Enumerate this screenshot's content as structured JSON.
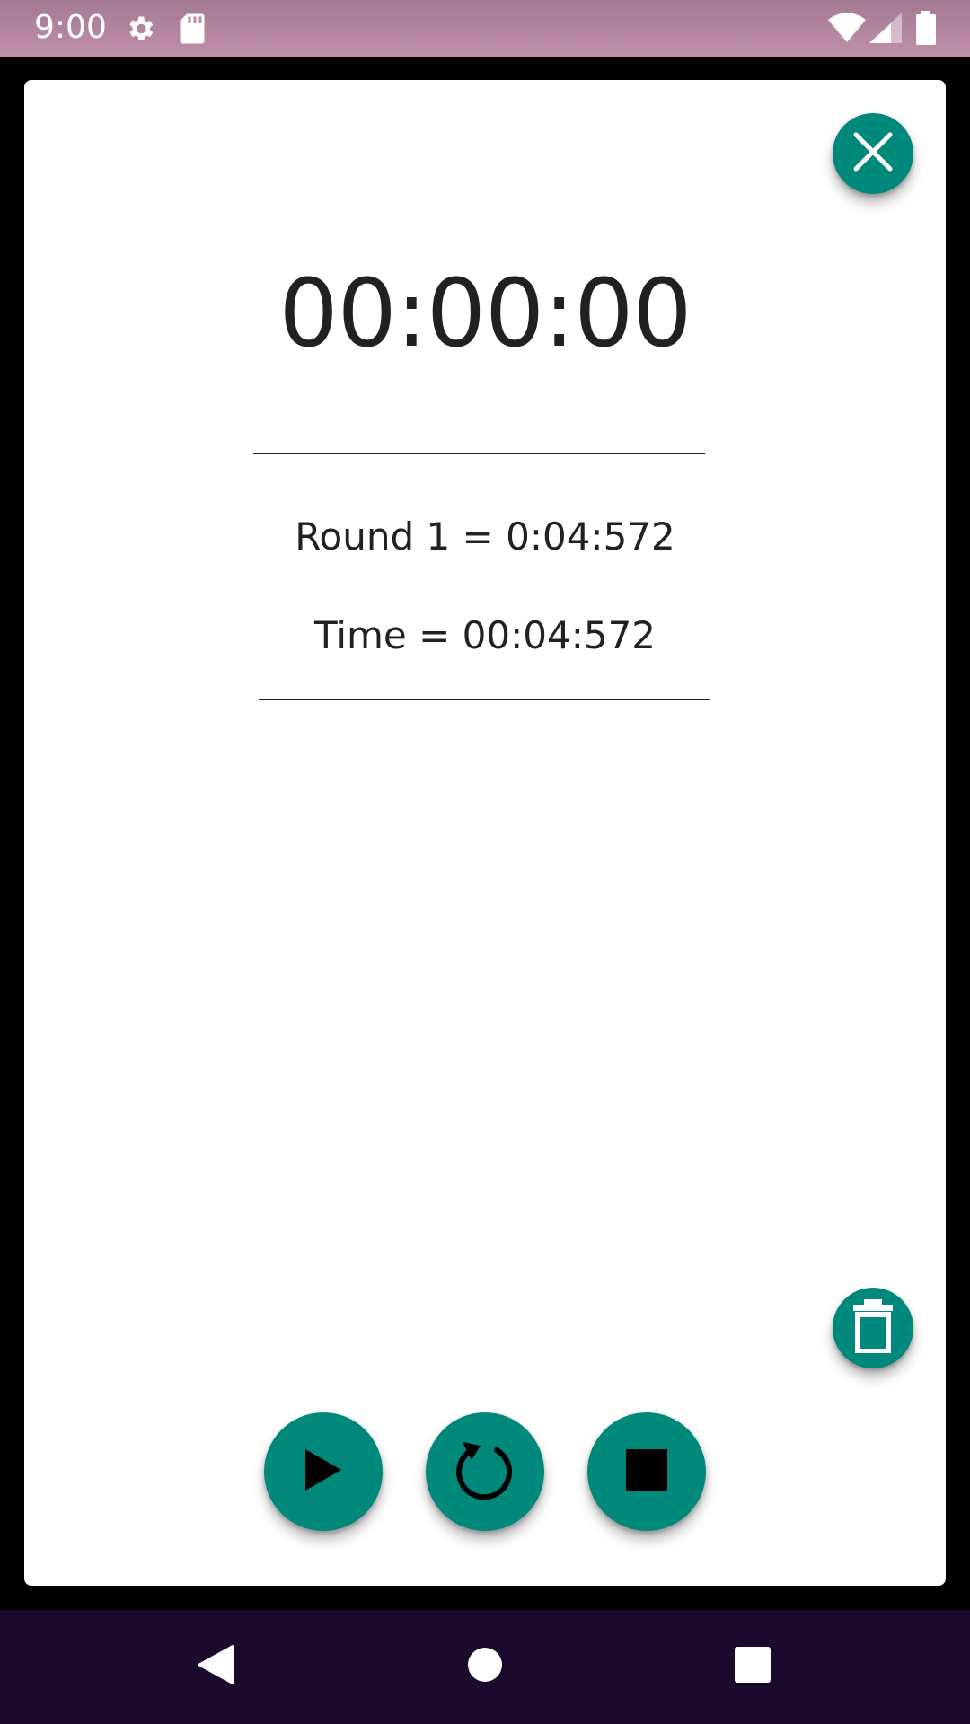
{
  "status_bar": {
    "time": "9:00",
    "icons": [
      "settings-icon",
      "sd-card-icon",
      "wifi-icon",
      "signal-icon",
      "battery-icon"
    ]
  },
  "stopwatch": {
    "display": "00:00:00",
    "laps": [
      "Round 1 = 0:04:572",
      "Time = 00:04:572"
    ]
  },
  "buttons": {
    "close": "close-icon",
    "delete": "trash-icon",
    "play": "play-icon",
    "reset": "refresh-icon",
    "stop": "stop-icon"
  },
  "nav_bar": {
    "icons": [
      "back-icon",
      "home-icon",
      "recents-icon"
    ]
  },
  "colors": {
    "accent": "#00897b",
    "status_bar": "#bf8fa9",
    "nav_bar": "#1c0a2c",
    "text": "#212121"
  }
}
